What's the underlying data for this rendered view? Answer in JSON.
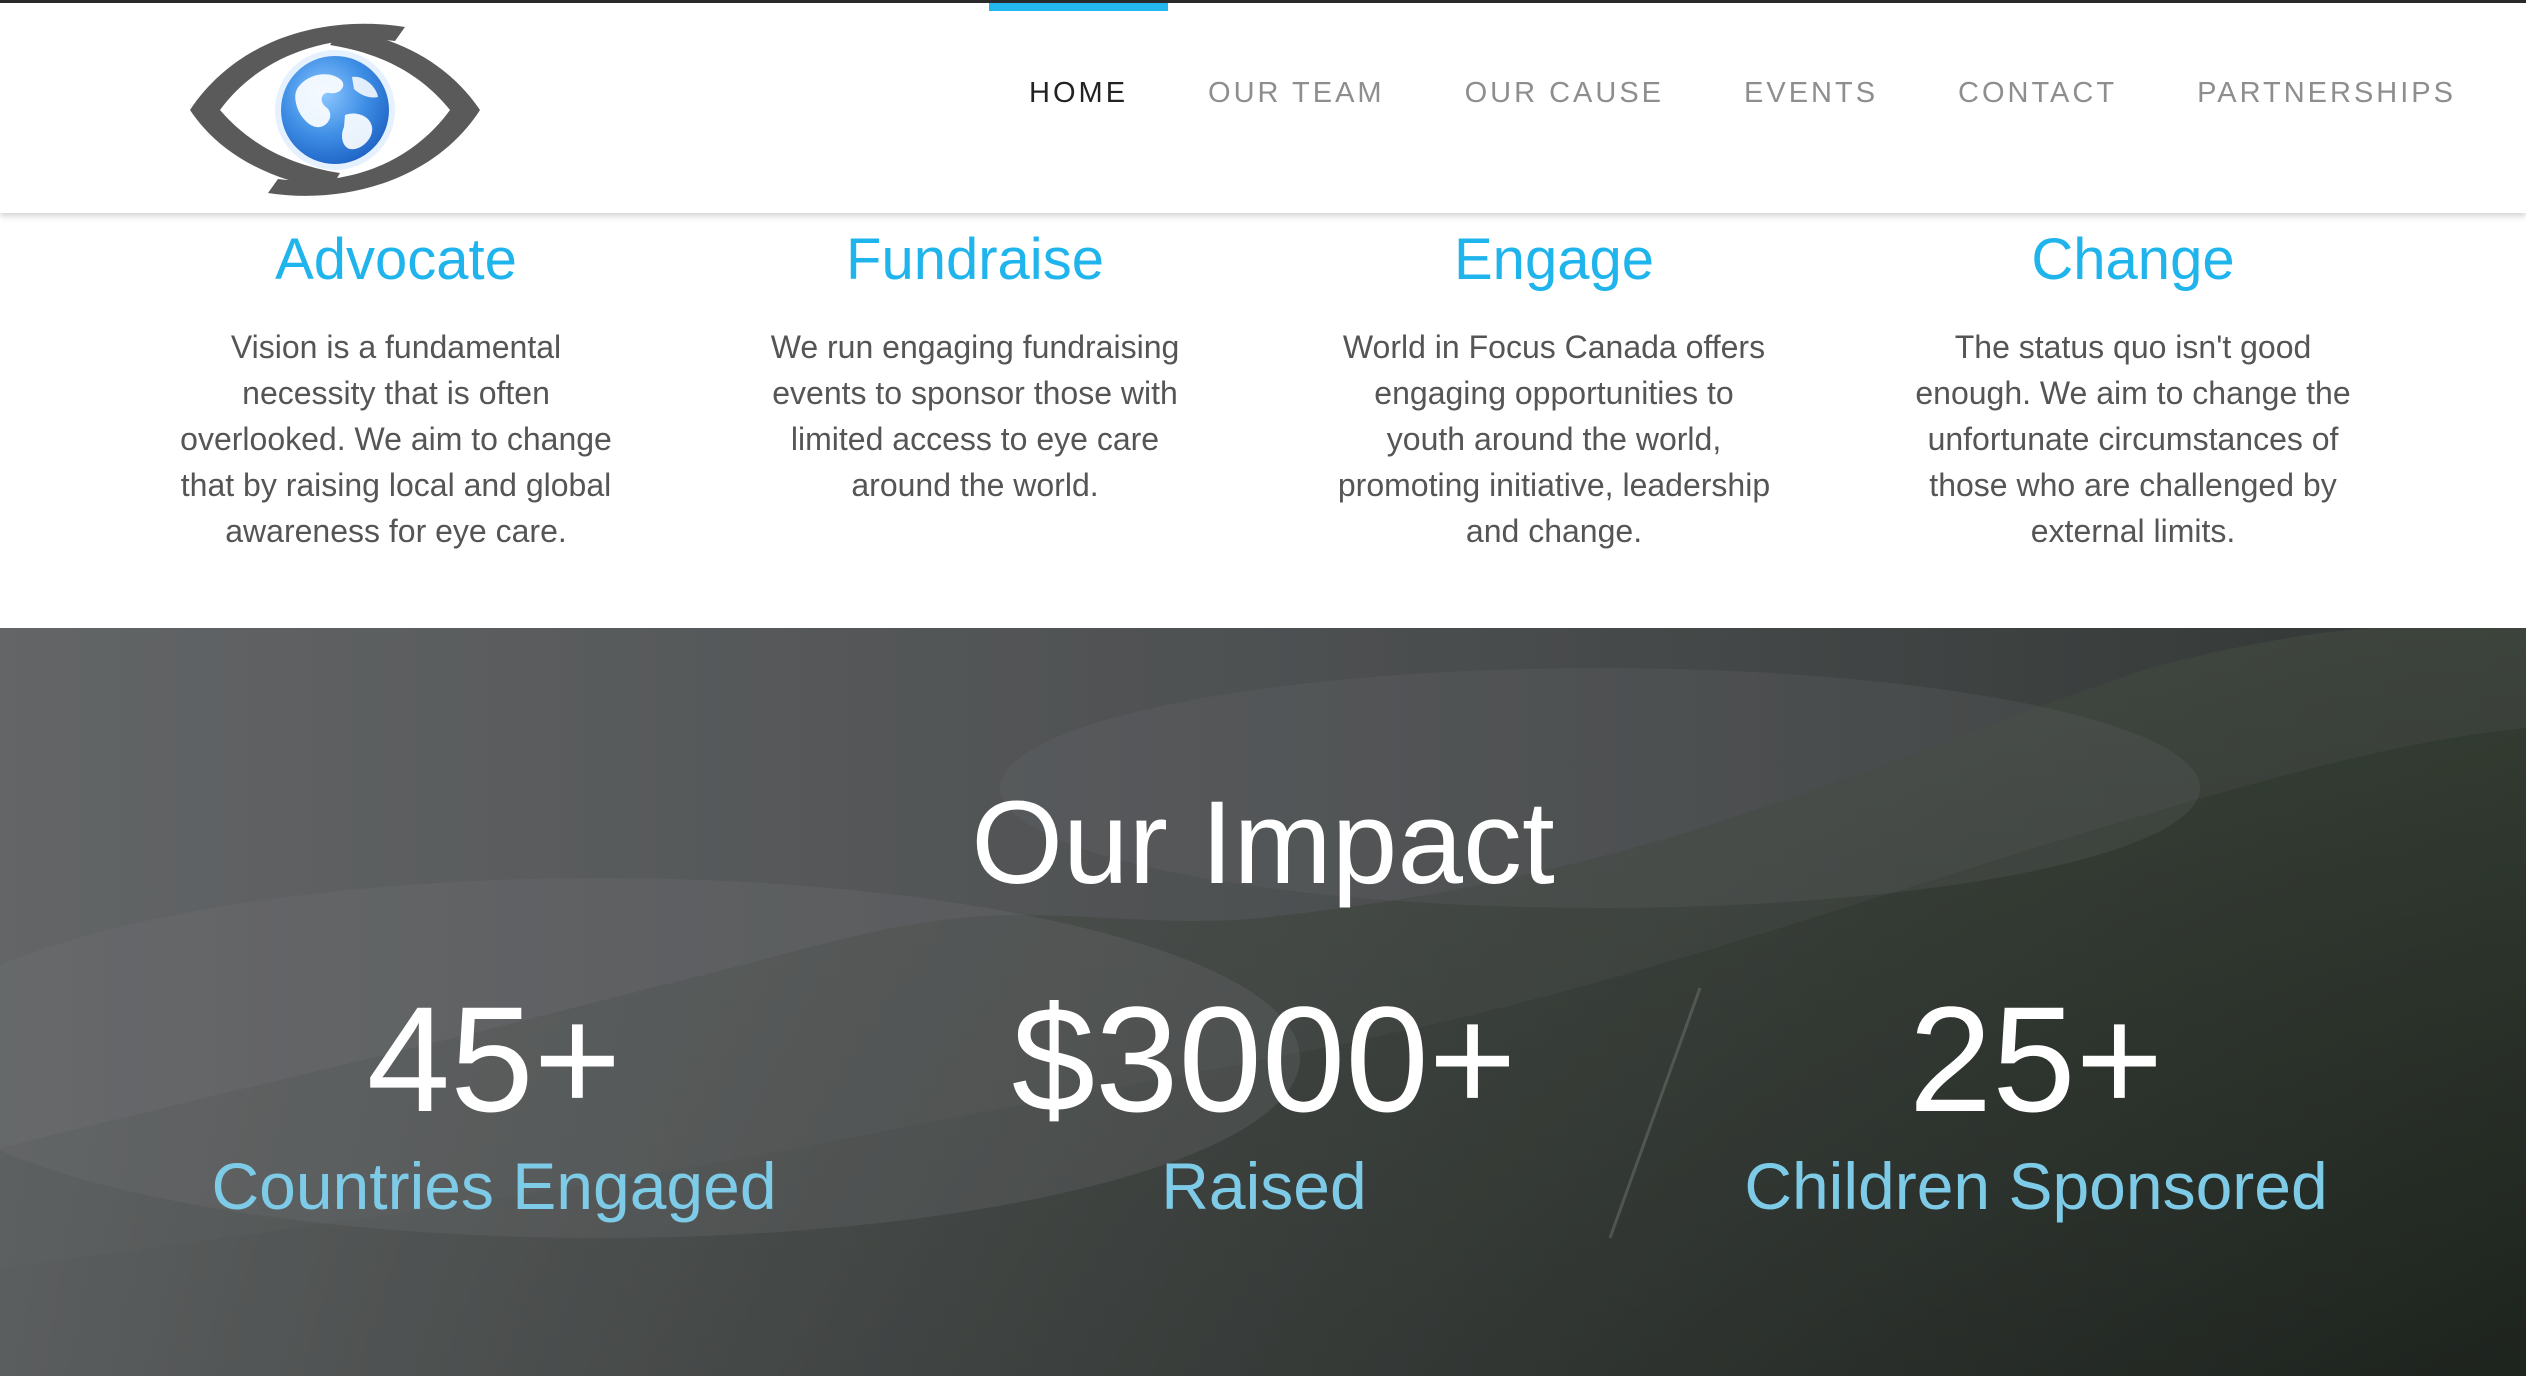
{
  "nav": {
    "items": [
      {
        "label": "HOME",
        "active": true
      },
      {
        "label": "OUR TEAM",
        "active": false
      },
      {
        "label": "OUR CAUSE",
        "active": false
      },
      {
        "label": "EVENTS",
        "active": false
      },
      {
        "label": "CONTACT",
        "active": false
      },
      {
        "label": "PARTNERSHIPS",
        "active": false
      }
    ]
  },
  "logo": {
    "icon": "eye-globe-icon"
  },
  "features": [
    {
      "title": "Advocate",
      "text": "Vision is a fundamental necessity that is often overlooked. We aim to change that by raising local and global awareness for eye care."
    },
    {
      "title": "Fundraise",
      "text": "We run engaging fundraising events to sponsor those with limited access to eye care around the world."
    },
    {
      "title": "Engage",
      "text": "World in Focus Canada offers engaging opportunities to youth around the world, promoting initiative, leadership and change."
    },
    {
      "title": "Change",
      "text": "The status quo isn't good enough. We aim to change the unfortunate circumstances of those who are challenged by external limits."
    }
  ],
  "impact": {
    "title": "Our Impact",
    "stats": [
      {
        "number": "45+",
        "label": "Countries Engaged"
      },
      {
        "number": "$3000+",
        "label": "Raised"
      },
      {
        "number": "25+",
        "label": "Children Sponsored"
      }
    ]
  },
  "colors": {
    "accent": "#1fb4ec",
    "stat_label": "#7ecbe8",
    "nav_active": "#222222",
    "nav_inactive": "#8e8e8e"
  }
}
